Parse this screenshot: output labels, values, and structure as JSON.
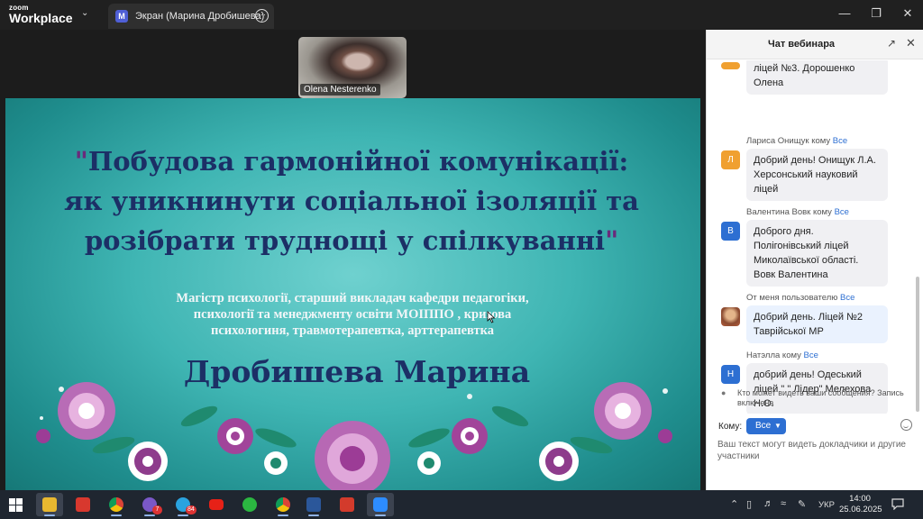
{
  "app": {
    "logo_line1": "zoom",
    "logo_line2": "Workplace",
    "share_tab": {
      "avatar_letter": "M",
      "title": "Экран (Марина Дробишева)"
    }
  },
  "video": {
    "participant_name": "Olena Nesterenko"
  },
  "slide": {
    "quote_open": "\"",
    "title_lines": [
      "Побудова гармонійної комунікації:",
      "як уникнинути соціальної ізоляції та",
      "розібрати труднощі у спілкуванні"
    ],
    "quote_close": "\"",
    "subtitle_lines": [
      "Магістр психології, старший викладач кафедри педагогіки,",
      "психології та менеджменту освіти МОІППО , кризова",
      "психологиня, травмотерапевтка, арттерапевтка"
    ],
    "author": "Дробишева Марина"
  },
  "chat": {
    "title": "Чат вебинара",
    "messages": [
      {
        "header": "",
        "to_all": "",
        "avatar": "",
        "avatar_color": "#f0a030",
        "text": "ліцей №3. Дорошенко\nОлена",
        "mine": false
      },
      {
        "header": "Лариса Онищук кому",
        "to_all": "Все",
        "avatar": "Л",
        "avatar_color": "#f0a030",
        "text": "Добрий день! Онищук Л.А.\nХерсонський науковий\nліцей",
        "mine": false
      },
      {
        "header": "Валентина Вовк кому",
        "to_all": "Все",
        "avatar": "В",
        "avatar_color": "#2d6fd2",
        "text": "Доброго дня.\nПолігонівський ліцей\nМиколаївської області.\nВовк Валентина",
        "mine": false
      },
      {
        "header": "От меня пользователю",
        "to_all": "Все",
        "avatar": "",
        "avatar_color": "#c88e5e",
        "text": "Добрий день. Ліцей №2\nТаврійської МР",
        "mine": true
      },
      {
        "header": "Натэлла кому",
        "to_all": "Все",
        "avatar": "Н",
        "avatar_color": "#2d6fd2",
        "text": "добрий день! Одеський\nліцей \" \" Лідер\" Мелехова\nН.О.",
        "mine": false
      }
    ],
    "privacy_note": "Кто может видеть ваши сообщения? Запись включена",
    "recipient_label": "Кому:",
    "recipient_value": "Все",
    "input_placeholder": "Ваш текст могут видеть докладчики и другие участники"
  },
  "taskbar": {
    "apps": [
      {
        "name": "file-explorer-icon",
        "color": "#e8b830",
        "badge": "",
        "running": true,
        "active": true
      },
      {
        "name": "app-red-icon",
        "color": "#d8382e",
        "badge": "",
        "running": false,
        "active": false
      },
      {
        "name": "chrome-icon",
        "color": "#3c9a4a",
        "badge": "",
        "running": true,
        "active": false
      },
      {
        "name": "viber-icon",
        "color": "#7a58c8",
        "badge": "7",
        "running": true,
        "active": false
      },
      {
        "name": "telegram-icon",
        "color": "#2aa3df",
        "badge": "84",
        "running": true,
        "active": false
      },
      {
        "name": "youtube-icon",
        "color": "#e62117",
        "badge": "",
        "running": false,
        "active": false
      },
      {
        "name": "whatsapp-icon",
        "color": "#2bb741",
        "badge": "",
        "running": false,
        "active": false
      },
      {
        "name": "chrome-icon",
        "color": "#3c9a4a",
        "badge": "",
        "running": true,
        "active": false
      },
      {
        "name": "word-icon",
        "color": "#2b579a",
        "badge": "",
        "running": true,
        "active": false
      },
      {
        "name": "pdf-icon",
        "color": "#d33b2c",
        "badge": "",
        "running": false,
        "active": false
      },
      {
        "name": "zoom-icon",
        "color": "#2d8cff",
        "badge": "",
        "running": true,
        "active": true
      }
    ],
    "language": "УКР",
    "time": "14:00",
    "date": "25.06.2025"
  }
}
